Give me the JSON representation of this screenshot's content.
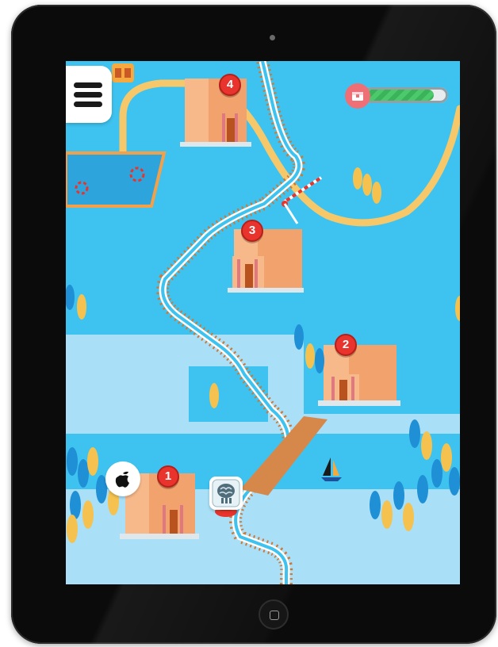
{
  "device": {
    "camera_icon": "front-camera-icon",
    "home_icon": "home-button-icon"
  },
  "hud": {
    "menu_icon": "hamburger-menu-icon",
    "chest_icon": "treasure-chest-icon",
    "progress_fraction": 0.85,
    "progress_color": "#43c062"
  },
  "buttons": {
    "apple_icon": "apple-logo-icon",
    "brain_icon": "brain-icon"
  },
  "levels": [
    {
      "number": "4"
    },
    {
      "number": "3"
    },
    {
      "number": "2"
    },
    {
      "number": "1"
    }
  ],
  "colors": {
    "water": "#3ec3f0",
    "lake": "#a9dff7",
    "track_tie": "#c97a3a",
    "building_wall": "#f2a26d",
    "marker_red": "#e8342c",
    "tree_blue": "#1f8fd6",
    "tree_yellow": "#f5c24f",
    "road": "#f7c86a"
  }
}
